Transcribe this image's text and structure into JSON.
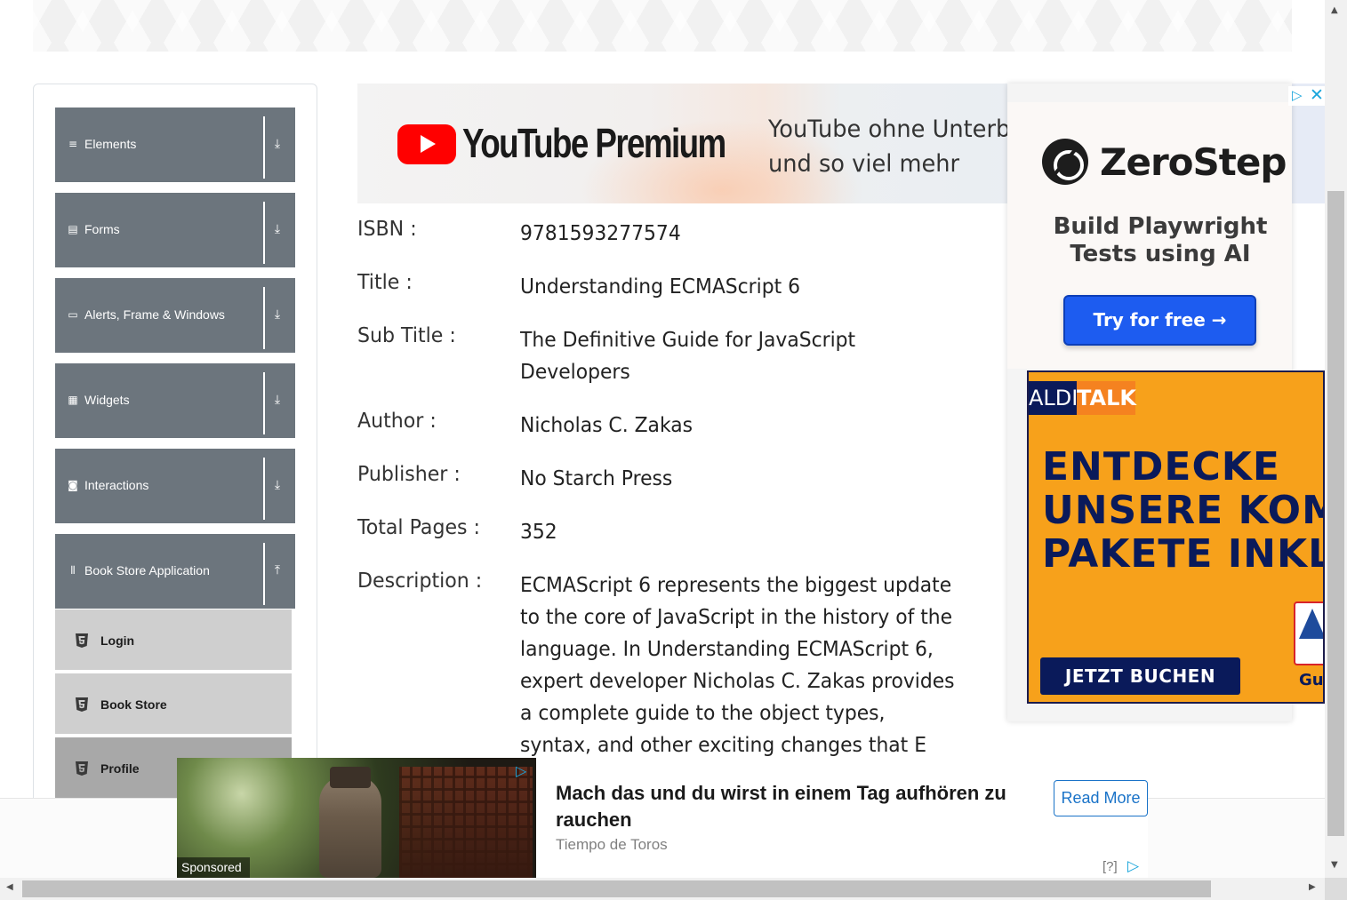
{
  "sidebar": {
    "groups": [
      {
        "label": "Elements",
        "icon": "≡",
        "arrow": "⤓"
      },
      {
        "label": "Forms",
        "icon": "▤",
        "arrow": "⤓"
      },
      {
        "label": "Alerts, Frame & Windows",
        "icon": "▭",
        "arrow": "⤓"
      },
      {
        "label": "Widgets",
        "icon": "▦",
        "arrow": "⤓"
      },
      {
        "label": "Interactions",
        "icon": "◙",
        "arrow": "⤓"
      },
      {
        "label": "Book Store Application",
        "icon": "⫴",
        "arrow": "⤒"
      }
    ],
    "book_store_items": [
      {
        "label": "Login"
      },
      {
        "label": "Book Store"
      },
      {
        "label": "Profile"
      }
    ]
  },
  "top_ad": {
    "wordmark": "YouTube Premium",
    "tagline_line1": "YouTube ohne Unterbre",
    "tagline_line2": "und so viel mehr"
  },
  "book": {
    "isbn_label": "ISBN :",
    "isbn": "9781593277574",
    "title_label": "Title :",
    "title": "Understanding ECMAScript 6",
    "subtitle_label": "Sub Title :",
    "subtitle": "The Definitive Guide for JavaScript Developers",
    "author_label": "Author :",
    "author": "Nicholas C. Zakas",
    "publisher_label": "Publisher :",
    "publisher": "No Starch Press",
    "pages_label": "Total Pages :",
    "pages": "352",
    "description_label": "Description :",
    "description": "ECMAScript 6 represents the biggest update to the core of JavaScript in the history of the language. In Understanding ECMAScript 6, expert developer Nicholas C. Zakas provides a complete guide to the object types, syntax, and other exciting changes that E"
  },
  "right_ad": {
    "brand": "ZeroStep",
    "headline": "Build Playwright Tests using AI",
    "button": "Try for free →",
    "aldi_left": "ALDI",
    "aldi_right": "TALK",
    "aldi_headline_1": "ENTDECKE",
    "aldi_headline_2": "UNSERE KOMI",
    "aldi_headline_3": "PAKETE INKL. ",
    "aldi_button": "JETZT BUCHEN",
    "aldi_badge_text": "Gut",
    "aldi_badge_logo": "AL"
  },
  "bottom_ad": {
    "sponsored": "Sponsored",
    "title": "Mach das und du wirst in einem Tag aufhören zu rauchen",
    "source": "Tiempo de Toros",
    "button": "Read More",
    "help": "[?]"
  },
  "colors": {
    "sidebar_header_bg": "#6c757d",
    "sub_item_bg": "#cfcfcf",
    "sub_item_active_bg": "#a8a8a8",
    "zerostep_button": "#1d5cf0",
    "aldi_orange": "#f7a11b",
    "aldi_navy": "#0a1a5a",
    "read_more_blue": "#1a73c8"
  }
}
